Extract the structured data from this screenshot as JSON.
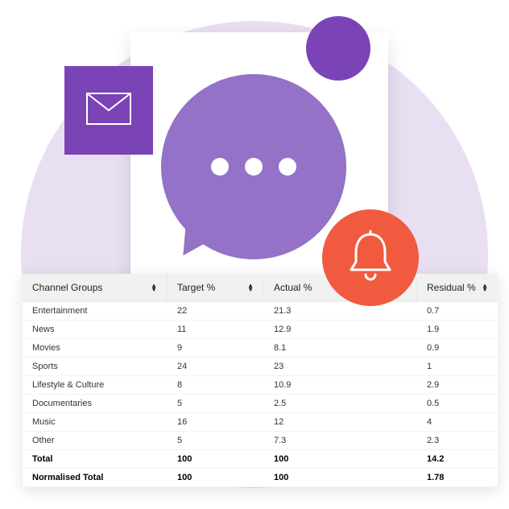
{
  "icons": {
    "mail": "mail-icon",
    "speech": "chat-icon",
    "bell": "bell-icon"
  },
  "colors": {
    "lilac_bg": "#e9dff3",
    "purple": "#7b44b6",
    "lavender": "#9372c7",
    "orange": "#f15a3f"
  },
  "table": {
    "columns": [
      "Channel Groups",
      "Target %",
      "Actual %",
      "Residual %"
    ],
    "rows": [
      {
        "group": "Entertainment",
        "target": "22",
        "actual": "21.3",
        "residual": "0.7",
        "bold": false
      },
      {
        "group": "News",
        "target": "11",
        "actual": "12.9",
        "residual": "1.9",
        "bold": false
      },
      {
        "group": "Movies",
        "target": "9",
        "actual": "8.1",
        "residual": "0.9",
        "bold": false
      },
      {
        "group": "Sports",
        "target": "24",
        "actual": "23",
        "residual": "1",
        "bold": false
      },
      {
        "group": "Lifestyle & Culture",
        "target": "8",
        "actual": "10.9",
        "residual": "2.9",
        "bold": false
      },
      {
        "group": "Documentaries",
        "target": "5",
        "actual": "2.5",
        "residual": "0.5",
        "bold": false
      },
      {
        "group": "Music",
        "target": "16",
        "actual": "12",
        "residual": "4",
        "bold": false
      },
      {
        "group": "Other",
        "target": "5",
        "actual": "7.3",
        "residual": "2.3",
        "bold": false
      },
      {
        "group": "Total",
        "target": "100",
        "actual": "100",
        "residual": "14.2",
        "bold": true
      },
      {
        "group": "Normalised Total",
        "target": "100",
        "actual": "100",
        "residual": "1.78",
        "bold": true
      }
    ]
  }
}
